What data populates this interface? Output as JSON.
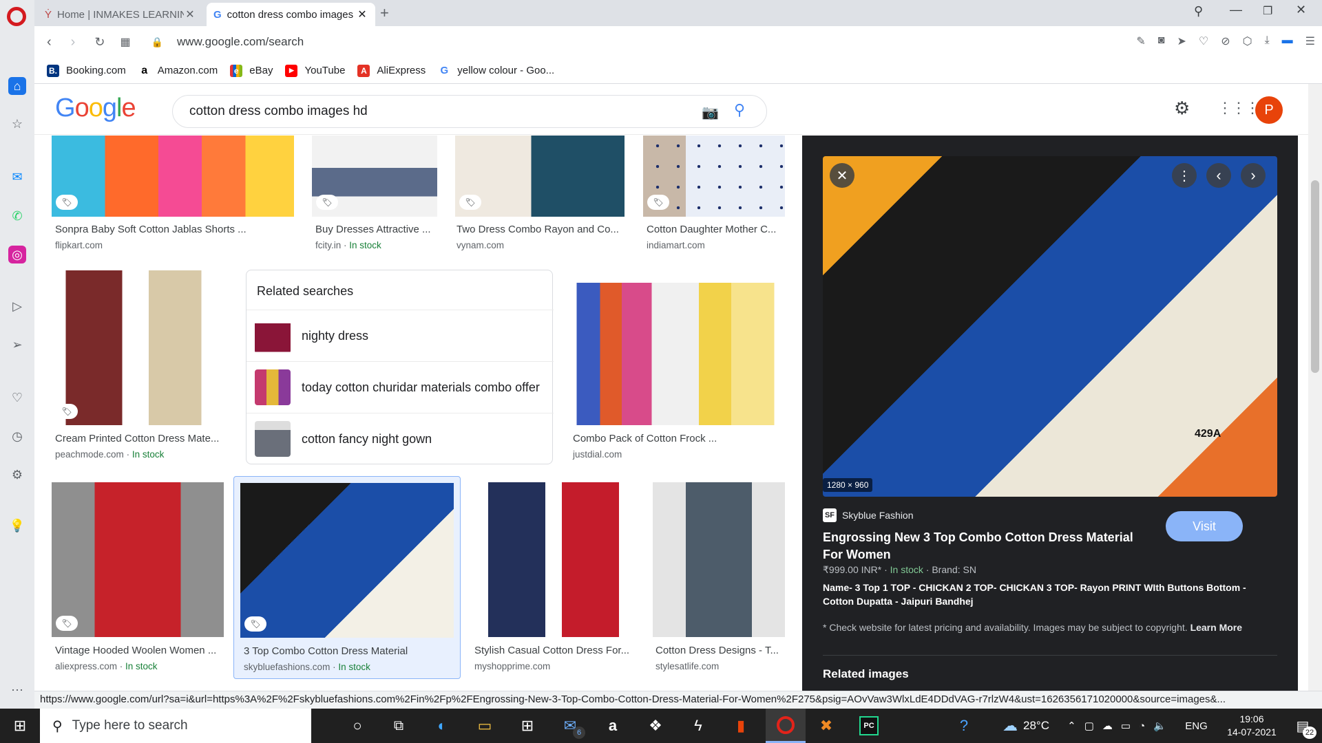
{
  "browser": {
    "tabs": [
      {
        "title": "Home | INMAKES LEARNING"
      },
      {
        "title": "cotton dress combo images hd"
      }
    ],
    "url": "www.google.com/search",
    "bookmarks": [
      {
        "label": "Booking.com",
        "glyph": "B.",
        "color": "#003580"
      },
      {
        "label": "Amazon.com",
        "glyph": "a",
        "color": "#000000"
      },
      {
        "label": "eBay",
        "glyph": "e",
        "color": "#e53238"
      },
      {
        "label": "YouTube",
        "glyph": "▶",
        "color": "#ff0000"
      },
      {
        "label": "AliExpress",
        "glyph": "A",
        "color": "#e43225"
      },
      {
        "label": "yellow colour - Goo...",
        "glyph": "G",
        "color": "#4285f4"
      }
    ]
  },
  "google": {
    "logo": "Google",
    "query": "cotton dress combo  images hd",
    "avatar_letter": "P"
  },
  "results": {
    "row1": [
      {
        "title": "Sonpra Baby Soft Cotton Jablas Shorts ...",
        "source": "flipkart.com",
        "stock": ""
      },
      {
        "title": "Buy Dresses Attractive ...",
        "source": "fcity.in",
        "stock": "In stock"
      },
      {
        "title": "Two Dress Combo Rayon and Co...",
        "source": "vynam.com",
        "stock": ""
      },
      {
        "title": "Cotton Daughter Mother C...",
        "source": "indiamart.com",
        "stock": ""
      }
    ],
    "row2": [
      {
        "title": "Cream Printed Cotton Dress Mate...",
        "source": "peachmode.com",
        "stock": "In stock"
      },
      {
        "title": "Combo Pack of Cotton Frock ...",
        "source": "justdial.com",
        "stock": ""
      }
    ],
    "related": {
      "heading": "Related searches",
      "items": [
        "nighty dress",
        "today cotton churidar materials combo offer",
        "cotton fancy night gown"
      ]
    },
    "row3": [
      {
        "title": "Vintage Hooded Woolen Women ...",
        "source": "aliexpress.com",
        "stock": "In stock"
      },
      {
        "title": "3 Top Combo Cotton Dress Material",
        "source": "skybluefashions.com",
        "stock": "In stock"
      },
      {
        "title": "Stylish Casual Cotton Dress For...",
        "source": "myshopprime.com",
        "stock": ""
      },
      {
        "title": "Cotton Dress Designs - T...",
        "source": "stylesatlife.com",
        "stock": ""
      }
    ]
  },
  "panel": {
    "dimensions": "1280 × 960",
    "image_label": "429A",
    "site": "Skyblue Fashion",
    "title": "Engrossing New 3 Top Combo Cotton Dress Material For Women",
    "price": "₹999.00 INR*",
    "stock": "In stock",
    "brand": "Brand: SN",
    "description": "Name- 3 Top 1 TOP - CHICKAN 2 TOP- CHICKAN 3 TOP- Rayon PRINT WIth Buttons Bottom - Cotton Dupatta - Jaipuri Bandhej",
    "disclaimer": "* Check website for latest pricing and availability. Images may be subject to copyright.",
    "learn_more": "Learn More",
    "visit": "Visit",
    "related_heading": "Related images"
  },
  "status_url": "https://www.google.com/url?sa=i&url=https%3A%2F%2Fskybluefashions.com%2Fin%2Fp%2FEngrossing-New-3-Top-Combo-Cotton-Dress-Material-For-Women%2F275&psig=AOvVaw3WlxLdE4DDdVAG-r7rlzW4&ust=1626356171020000&source=images&...",
  "taskbar": {
    "search_placeholder": "Type here to search",
    "weather": "28°C",
    "lang": "ENG",
    "time": "19:06",
    "date": "14-07-2021",
    "mail_badge": "6",
    "notif_badge": "22"
  }
}
